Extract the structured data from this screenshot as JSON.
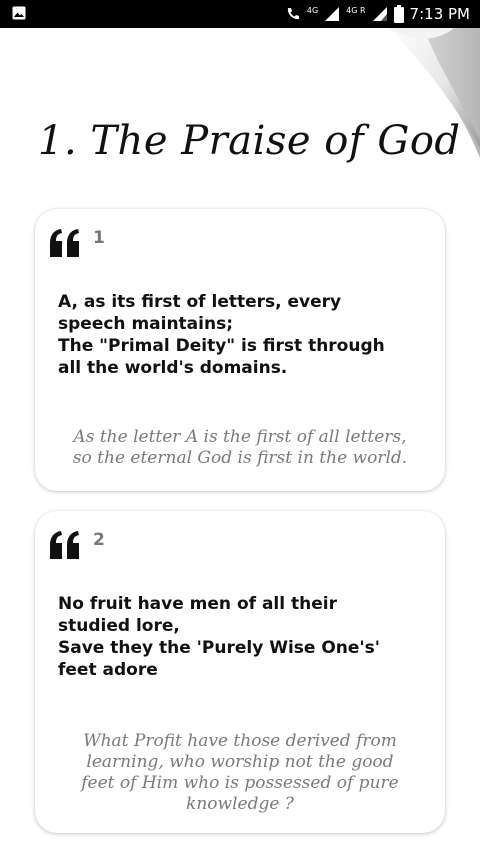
{
  "status_bar": {
    "time": "7:13 PM",
    "network_labels": [
      "4G",
      "4G R"
    ],
    "icons": [
      "image-icon",
      "call-icon",
      "signal-icon",
      "battery-icon"
    ]
  },
  "title": "1. The Praise of God",
  "cards": [
    {
      "number": "1",
      "verse_lines": [
        "A, as its first of letters, every",
        "speech maintains;",
        "The \"Primal Deity\" is first through",
        "all the world's domains."
      ],
      "meaning_lines": [
        "As the letter A is the first of all letters,",
        "so the eternal God is first in the world."
      ]
    },
    {
      "number": "2",
      "verse_lines": [
        "No fruit have men of all their",
        "studied lore,",
        "Save they the 'Purely Wise One's'",
        "feet adore"
      ],
      "meaning_lines": [
        "What Profit have those derived from",
        "learning, who worship not the good",
        "feet of Him who is possessed of pure",
        "knowledge ?"
      ]
    }
  ],
  "colors": {
    "status_bar": "#000000",
    "background": "#ffffff",
    "verse_text": "#111111",
    "meaning_text": "#7a7a7a",
    "number_text": "#777777"
  }
}
